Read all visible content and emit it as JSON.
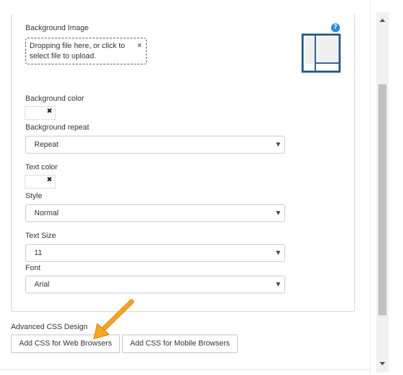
{
  "background_image": {
    "label": "Background Image",
    "dropzone_text": "Dropping file here, or click to select file to upload.",
    "clear_glyph": "×",
    "help_glyph": "?",
    "layout_icon": "layout-thumbnail-icon"
  },
  "background_color": {
    "label": "Background color",
    "clear_glyph": "✖"
  },
  "background_repeat": {
    "label": "Background repeat",
    "selected": "Repeat"
  },
  "text_color": {
    "label": "Text color",
    "clear_glyph": "✖"
  },
  "style": {
    "label": "Style",
    "selected": "Normal"
  },
  "text_size": {
    "label": "Text Size",
    "selected": "11"
  },
  "font": {
    "label": "Font",
    "selected": "Arial"
  },
  "dropdown_glyph": "▼",
  "advanced_css": {
    "label": "Advanced CSS Design",
    "web_button": "Add CSS for Web Browsers",
    "mobile_button": "Add CSS for Mobile Browsers"
  },
  "colors": {
    "help_icon": "#2f8fd8",
    "thumbnail_frame": "#2d5b8c",
    "annotation_arrow": "#f5a623"
  }
}
